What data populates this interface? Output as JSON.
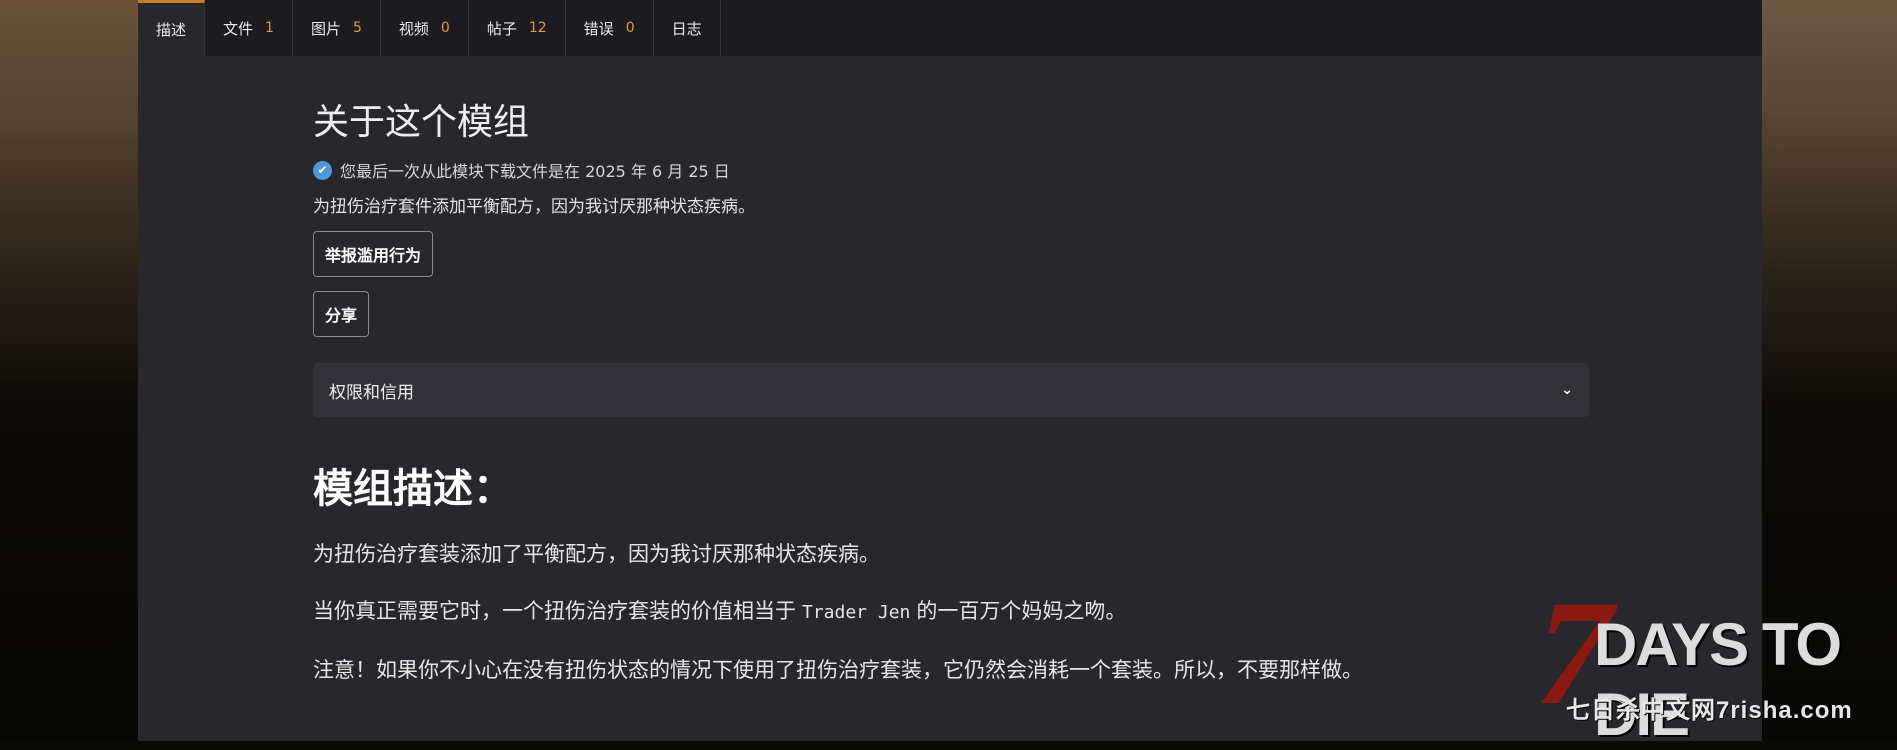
{
  "tabs": [
    {
      "label": "描述",
      "count": ""
    },
    {
      "label": "文件",
      "count": "1"
    },
    {
      "label": "图片",
      "count": "5"
    },
    {
      "label": "视频",
      "count": "0"
    },
    {
      "label": "帖子",
      "count": "12"
    },
    {
      "label": "错误",
      "count": "0"
    },
    {
      "label": "日志",
      "count": ""
    }
  ],
  "about": {
    "title": "关于这个模组",
    "download_note": "您最后一次从此模块下载文件是在 2025 年 6 月 25 日",
    "summary": "为扭伤治疗套件添加平衡配方，因为我讨厌那种状态疾病。",
    "report_button": "举报滥用行为",
    "share_button": "分享",
    "permissions_label": "权限和信用"
  },
  "description": {
    "title": "模组描述：",
    "p1": "为扭伤治疗套装添加了平衡配方，因为我讨厌那种状态疾病。",
    "p2_before": "当你真正需要它时，一个扭伤治疗套装的价值相当于",
    "p2_code": "Trader Jen",
    "p2_after": "的一百万个妈妈之吻。",
    "p3": "注意！如果你不小心在没有扭伤状态的情况下使用了扭伤治疗套装，它仍然会消耗一个套装。所以，不要那样做。"
  },
  "watermark": {
    "logo_number": "7",
    "logo_text": "DAYS TO DIE",
    "site_text": "七日杀中文网7risha.com"
  },
  "colors": {
    "accent": "#c77c2e",
    "count": "#e39b3c",
    "check": "#4d9ad6",
    "logo_red": "#8c1a12"
  }
}
